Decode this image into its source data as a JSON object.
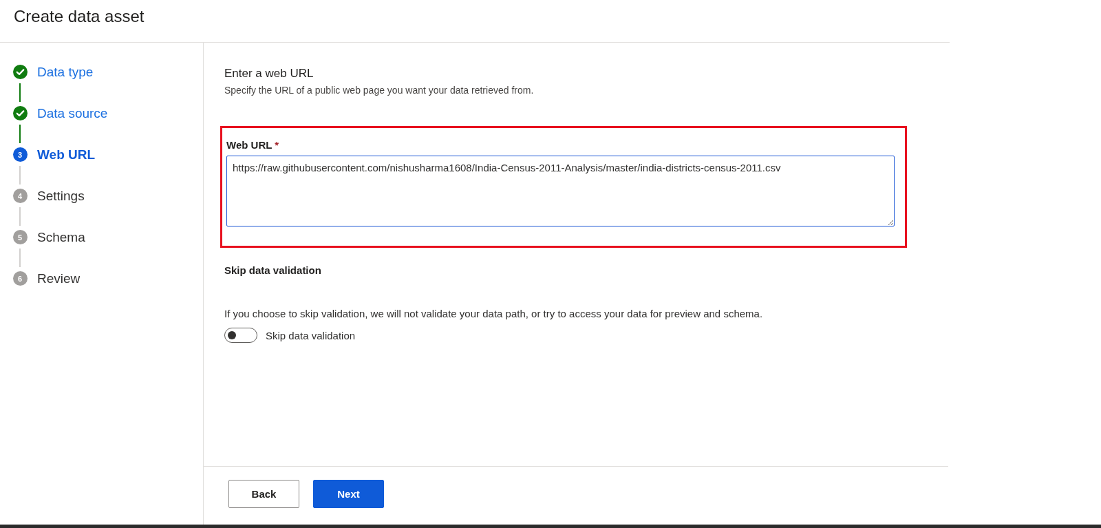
{
  "window": {
    "title": "Create data asset"
  },
  "steps": [
    {
      "label": "Data type",
      "kind": "done"
    },
    {
      "label": "Data source",
      "kind": "done"
    },
    {
      "label": "Web URL",
      "kind": "current",
      "number": "3"
    },
    {
      "label": "Settings",
      "kind": "pending",
      "number": "4"
    },
    {
      "label": "Schema",
      "kind": "pending",
      "number": "5"
    },
    {
      "label": "Review",
      "kind": "pending",
      "number": "6"
    }
  ],
  "section": {
    "title": "Enter a web URL",
    "description": "Specify the URL of a public web page you want your data retrieved from."
  },
  "web_url": {
    "label": "Web URL",
    "required_mark": "*",
    "value": "https://raw.githubusercontent.com/nishusharma1608/India-Census-2011-Analysis/master/india-districts-census-2011.csv",
    "highlighted": true
  },
  "skip_validation": {
    "title": "Skip data validation",
    "description": "If you choose to skip validation, we will not validate your data path, or try to access your data for preview and schema.",
    "toggle_label": "Skip data validation",
    "on": false
  },
  "buttons": [
    {
      "label": "Back",
      "kind": "secondary"
    },
    {
      "label": "Next",
      "kind": "primary"
    }
  ]
}
